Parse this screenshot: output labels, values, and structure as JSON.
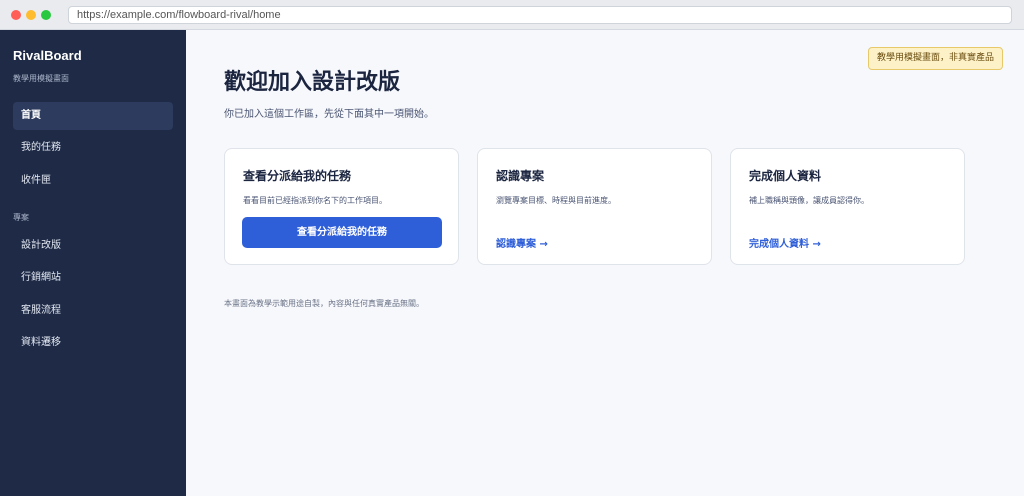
{
  "browser": {
    "url": "https://example.com/flowboard-rival/home"
  },
  "sidebar": {
    "brand": "RivalBoard",
    "brand_sub": "教學用模擬畫面",
    "nav": [
      {
        "label": "首頁",
        "active": true
      },
      {
        "label": "我的任務"
      },
      {
        "label": "收件匣"
      }
    ],
    "section_label": "專案",
    "projects": [
      {
        "label": "設計改版"
      },
      {
        "label": "行銷網站"
      },
      {
        "label": "客服流程"
      },
      {
        "label": "資料遷移"
      }
    ]
  },
  "main": {
    "badge": "教學用模擬畫面，非真實產品",
    "title": "歡迎加入設計改版",
    "subtitle": "你已加入這個工作區，先從下面其中一項開始。",
    "cards": [
      {
        "title": "查看分派給我的任務",
        "desc": "看看目前已經指派到你名下的工作項目。",
        "button": "查看分派給我的任務"
      },
      {
        "title": "認識專案",
        "desc": "瀏覽專案目標、時程與目前進度。",
        "link": "認識專案 →"
      },
      {
        "title": "完成個人資料",
        "desc": "補上職稱與頭像，讓成員認得你。",
        "link": "完成個人資料 →"
      }
    ],
    "footer_note": "本畫面為教學示範用途自製，內容與任何真實產品無關。"
  },
  "colors": {
    "sidebar_bg": "#1e2a46",
    "accent": "#2f5fd8",
    "badge_bg": "#fdf1c7"
  }
}
